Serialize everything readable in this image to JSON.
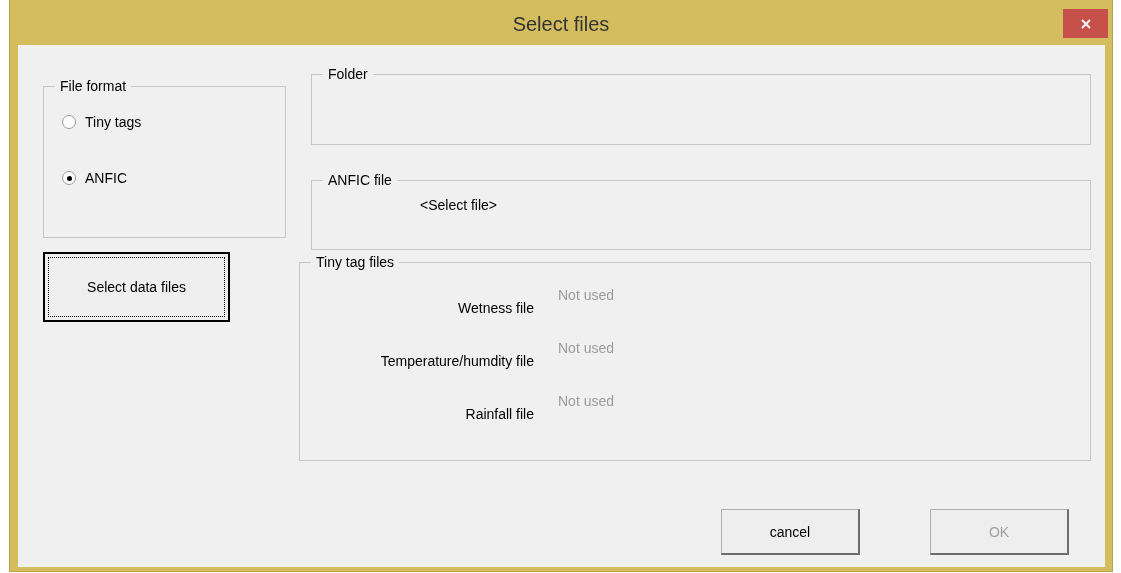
{
  "window": {
    "title": "Select files"
  },
  "file_format": {
    "legend": "File format",
    "options": [
      {
        "label": "Tiny tags",
        "selected": false
      },
      {
        "label": "ANFIC",
        "selected": true
      }
    ]
  },
  "select_button": {
    "label": "Select data files",
    "focused": true
  },
  "folder": {
    "legend": "Folder"
  },
  "anfic_file": {
    "legend": "ANFIC file",
    "value": "<Select file>"
  },
  "tiny_tag_files": {
    "legend": "Tiny tag files",
    "rows": [
      {
        "label": "Wetness file",
        "value": "Not used",
        "disabled": true
      },
      {
        "label": "Temperature/humdity file",
        "value": "Not used",
        "disabled": true
      },
      {
        "label": "Rainfall file",
        "value": "Not used",
        "disabled": true
      }
    ]
  },
  "buttons": [
    {
      "label": "cancel",
      "disabled": false
    },
    {
      "label": "OK",
      "disabled": true
    }
  ]
}
